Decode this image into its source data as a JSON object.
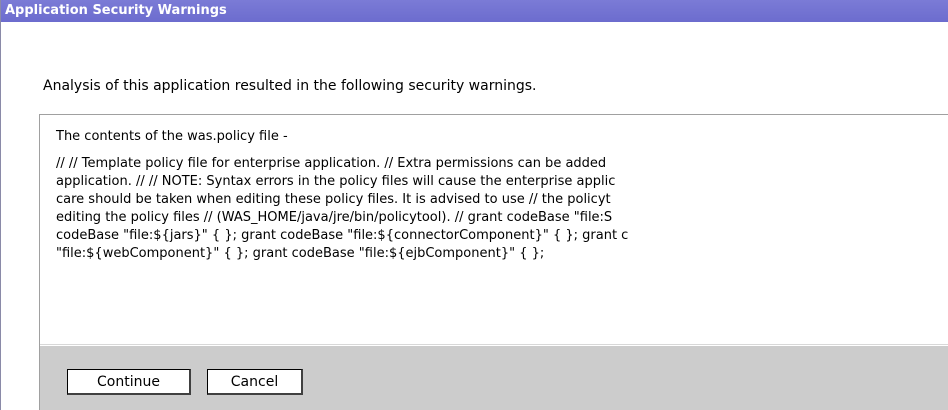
{
  "window": {
    "title": "Application Security Warnings"
  },
  "intro_text": "Analysis of this application resulted in the following security warnings.",
  "panel": {
    "heading": "The contents of the was.policy file -",
    "policy_lines": [
      "// // Template policy file for enterprise application. // Extra permissions can be added",
      "application. // // NOTE: Syntax errors in the policy files will cause the enterprise applic",
      "care should be taken when editing these policy files. It is advised to use // the policyt",
      "editing the policy files // (WAS_HOME/java/jre/bin/policytool). // grant codeBase \"file:S",
      "codeBase \"file:${jars}\" { }; grant codeBase \"file:${connectorComponent}\" { }; grant c",
      "\"file:${webComponent}\" { }; grant codeBase \"file:${ejbComponent}\" { };"
    ]
  },
  "buttons": {
    "continue_label": "Continue",
    "cancel_label": "Cancel"
  },
  "colors": {
    "titlebar": "#6c6cce",
    "button_bar": "#cccccc"
  }
}
